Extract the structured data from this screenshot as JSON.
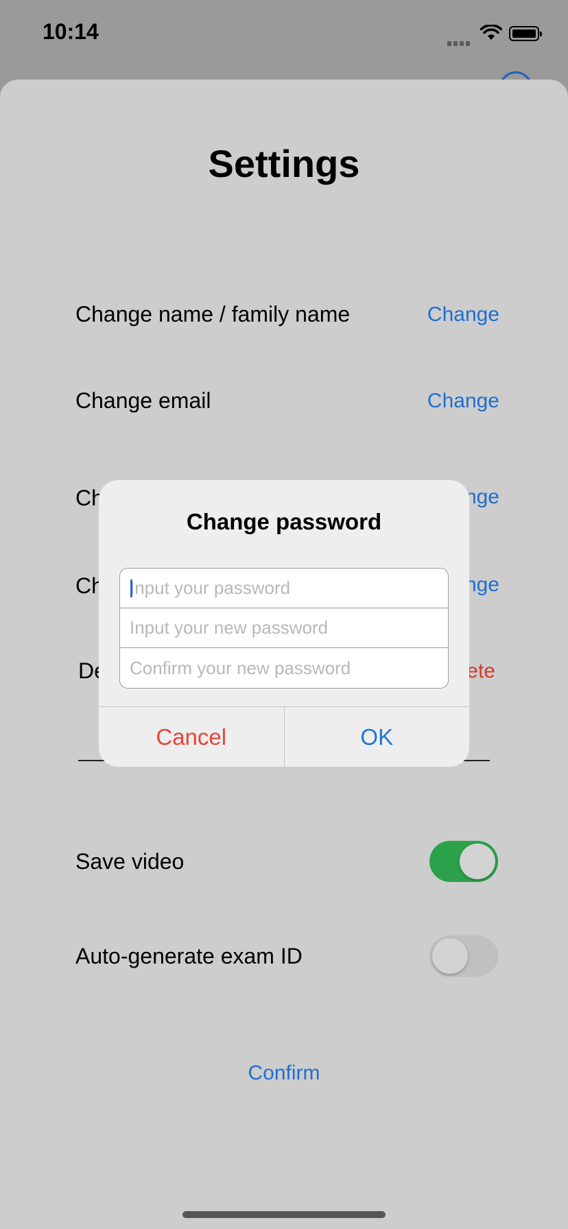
{
  "status_bar": {
    "time": "10:14"
  },
  "settings": {
    "title": "Settings",
    "rows": [
      {
        "label": "Change name / family name",
        "action": "Change"
      },
      {
        "label": "Change email",
        "action": "Change"
      },
      {
        "label": "Ch",
        "action": "nge"
      },
      {
        "label": "Ch",
        "action": "nge"
      },
      {
        "label": "De",
        "action": "ete"
      }
    ],
    "toggles": [
      {
        "label": "Save video",
        "on": true
      },
      {
        "label": "Auto-generate exam ID",
        "on": false
      }
    ],
    "confirm_label": "Confirm"
  },
  "dialog": {
    "title": "Change password",
    "fields": [
      {
        "placeholder": "Input your password",
        "value": ""
      },
      {
        "placeholder": "Input your new password",
        "value": ""
      },
      {
        "placeholder": "Confirm your new password",
        "value": ""
      }
    ],
    "cancel_label": "Cancel",
    "ok_label": "OK"
  },
  "colors": {
    "accent": "#1e6fcf",
    "destructive": "#d23a2e",
    "toggle_on": "#2ba24a"
  }
}
